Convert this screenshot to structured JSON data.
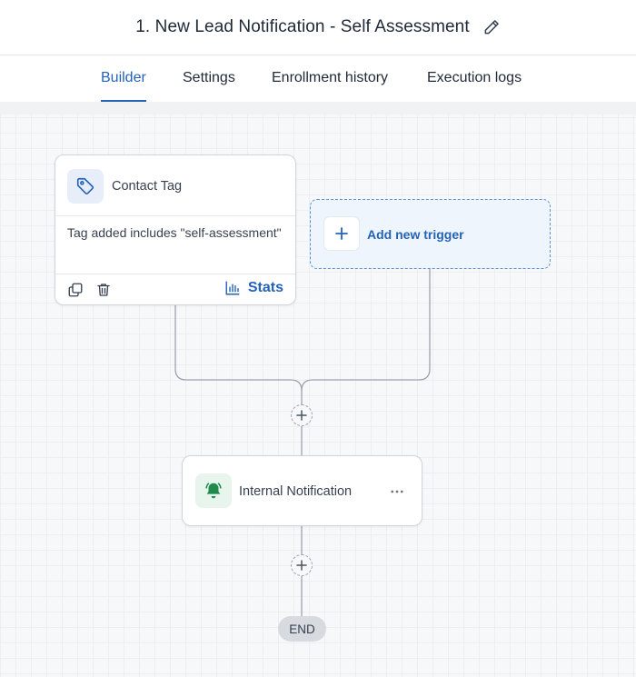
{
  "header": {
    "title": "1. New Lead Notification - Self Assessment",
    "edit_icon": "pencil-icon"
  },
  "tabs": [
    {
      "label": "Builder",
      "active": true
    },
    {
      "label": "Settings",
      "active": false
    },
    {
      "label": "Enrollment history",
      "active": false
    },
    {
      "label": "Execution logs",
      "active": false
    }
  ],
  "trigger": {
    "name": "Contact Tag",
    "icon": "tag-icon",
    "description": "Tag added includes \"self-assessment\"",
    "stats_label": "Stats"
  },
  "add_trigger": {
    "label": "Add new trigger"
  },
  "action": {
    "name": "Internal Notification",
    "icon": "bell-icon"
  },
  "end": {
    "label": "END"
  },
  "colors": {
    "accent": "#2563b8",
    "bell_green": "#1e8a4c",
    "canvas_bg": "#f7f8fa"
  }
}
